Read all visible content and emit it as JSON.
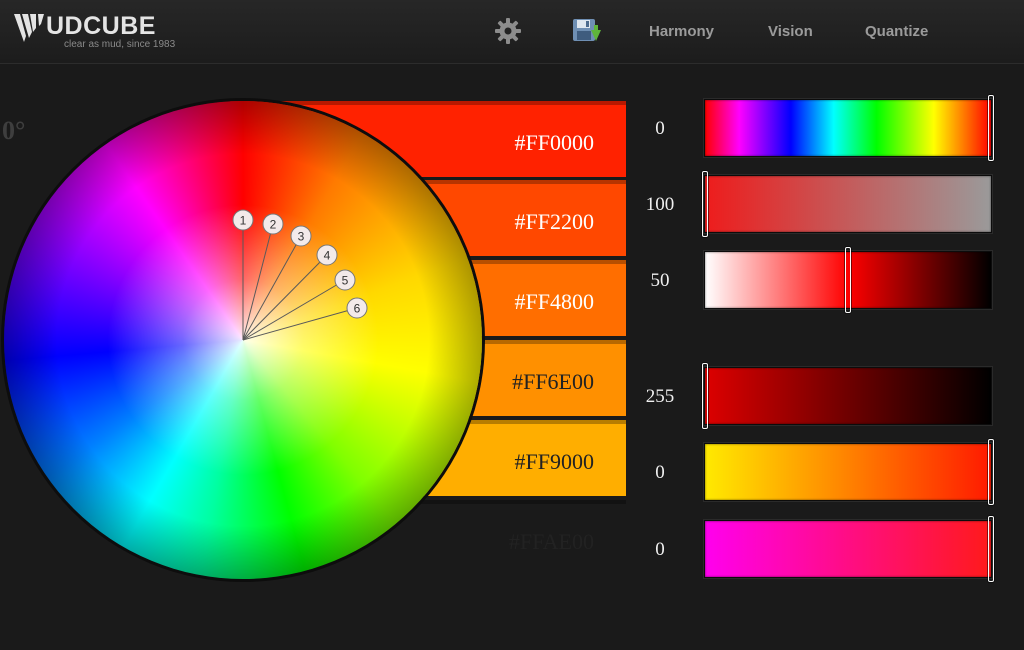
{
  "app": {
    "logo_text": "UDCUBE",
    "tagline": "clear as mud, since 1983"
  },
  "nav": {
    "icons": [
      "gear-icon",
      "save-icon"
    ],
    "links": [
      "Harmony",
      "Vision",
      "Quantize"
    ]
  },
  "wheel": {
    "angle_label": "0°",
    "markers": [
      "1",
      "2",
      "3",
      "4",
      "5",
      "6"
    ]
  },
  "swatches": [
    {
      "hex": "#FF0000",
      "color": "#FF0000"
    },
    {
      "hex": "#FF2200",
      "color": "#FF2200"
    },
    {
      "hex": "#FF4800",
      "color": "#FF4800"
    },
    {
      "hex": "#FF6E00",
      "color": "#FF6E00"
    },
    {
      "hex": "#FF9000",
      "color": "#FF9000"
    },
    {
      "hex": "#FFAE00",
      "color": "#FFAE00"
    }
  ],
  "sliders": [
    {
      "value": "0",
      "level": 1.0
    },
    {
      "value": "100",
      "level": 0.0
    },
    {
      "value": "50",
      "level": 0.5
    },
    {
      "value": "255",
      "level": 0.0
    },
    {
      "value": "0",
      "level": 1.0
    },
    {
      "value": "0",
      "level": 1.0
    }
  ]
}
